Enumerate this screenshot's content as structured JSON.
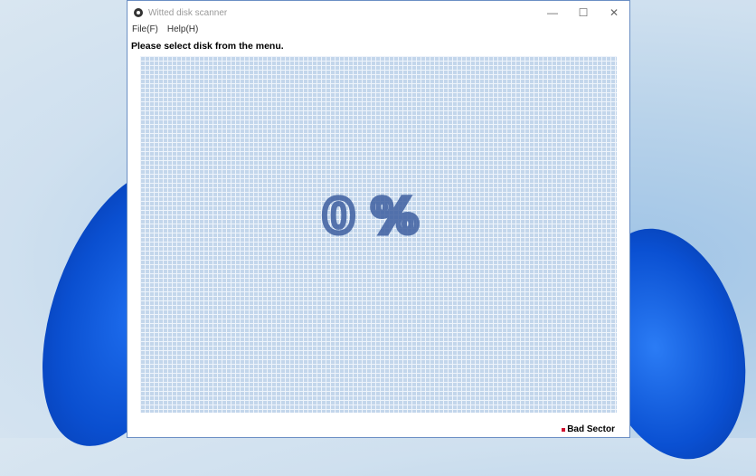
{
  "window": {
    "title": "Witted disk scanner",
    "controls": {
      "minimize": "—",
      "maximize": "☐",
      "close": "✕"
    }
  },
  "menu": [
    {
      "label": "File(F)"
    },
    {
      "label": "Help(H)"
    }
  ],
  "status_text": "Please select disk from the menu.",
  "scan": {
    "progress_text": "0%",
    "progress_percent": 0
  },
  "legend": {
    "label": "Bad Sector",
    "color": "#d01030"
  }
}
